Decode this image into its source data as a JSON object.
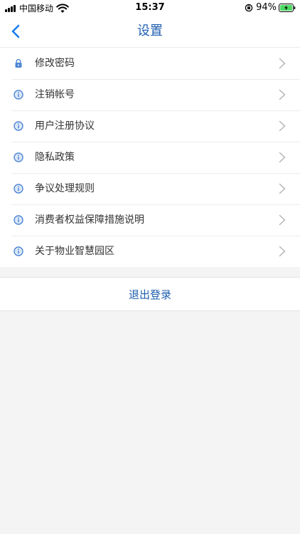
{
  "status_bar": {
    "carrier": "中国移动",
    "time": "15:37",
    "battery": "94%"
  },
  "nav": {
    "title": "设置"
  },
  "colors": {
    "accent": "#1f5fb0",
    "icon_blue": "#4f86d6",
    "chevron": "#b4b4b4",
    "back": "#1a7cf0"
  },
  "settings": {
    "items": [
      {
        "label": "修改密码",
        "icon": "lock-icon"
      },
      {
        "label": "注销帐号",
        "icon": "info-icon"
      },
      {
        "label": "用户注册协议",
        "icon": "info-icon"
      },
      {
        "label": "隐私政策",
        "icon": "info-icon"
      },
      {
        "label": "争议处理规则",
        "icon": "info-icon"
      },
      {
        "label": "消费者权益保障措施说明",
        "icon": "info-icon"
      },
      {
        "label": "关于物业智慧园区",
        "icon": "info-icon"
      }
    ]
  },
  "logout": {
    "label": "退出登录"
  }
}
